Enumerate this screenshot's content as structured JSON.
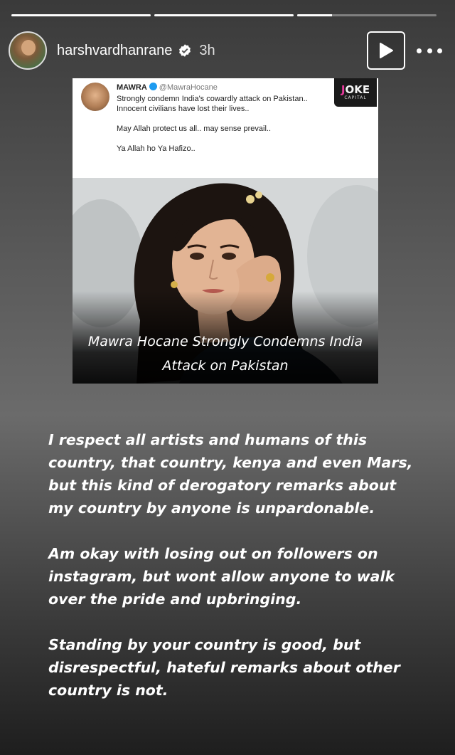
{
  "story": {
    "progress": [
      1.0,
      1.0,
      0.25
    ]
  },
  "header": {
    "username": "harshvardhanrane",
    "time": "3h",
    "verified_icon": "verified-badge-icon",
    "play_icon": "play-icon",
    "more_icon": "more-options-icon"
  },
  "post": {
    "tweet": {
      "name": "MAWRA",
      "handle": "@MawraHocane",
      "lines": [
        "Strongly condemn India's cowardly attack on Pakistan..",
        "Innocent civilians have lost their lives..",
        "May Allah protect us all.. may sense prevail..",
        "Ya Allah ho Ya Hafizo.."
      ]
    },
    "logo": {
      "top": "JOKE",
      "bottom": "CAPITAL"
    },
    "caption_line1": "Mawra Hocane Strongly Condemns India",
    "caption_line2": "Attack on Pakistan"
  },
  "story_text": {
    "p1": "I respect all artists and humans of this country, that country, kenya and even Mars, but this kind of derogatory remarks about my country by anyone is unpardonable.",
    "p2": "Am okay with losing out on followers on instagram, but wont allow anyone to walk over the pride and upbringing.",
    "p3": "Standing by your country is good, but disrespectful, hateful remarks about other country is not."
  },
  "colors": {
    "verified": "#ffffff",
    "tweet_verified": "#1d9bf0",
    "logo_accent": "#e5399b"
  }
}
